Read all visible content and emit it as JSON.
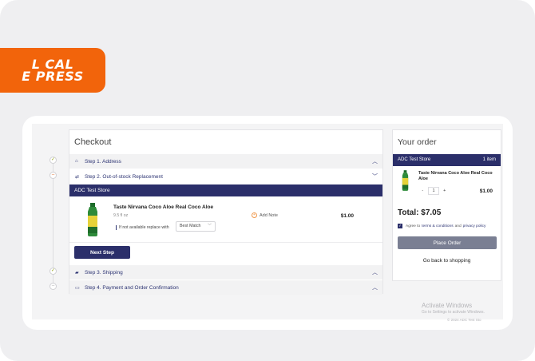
{
  "brand": {
    "logo_line1": "L CAL",
    "logo_line2": "E PRESS",
    "accent": "#f2640b",
    "navy": "#2b2f6a"
  },
  "checkout": {
    "title": "Checkout",
    "steps": [
      {
        "label": "Step 1. Address",
        "icon": "home-icon",
        "state": "collapsed",
        "status": "done"
      },
      {
        "label": "Step 2. Out-of-stock Replacement",
        "icon": "swap-icon",
        "state": "expanded",
        "status": "current"
      },
      {
        "label": "Step 3. Shipping",
        "icon": "truck-icon",
        "state": "collapsed",
        "status": "done"
      },
      {
        "label": "Step 4. Payment and Order Confirmation",
        "icon": "card-icon",
        "state": "collapsed",
        "status": "pending"
      }
    ],
    "store_name": "ADC Test Store",
    "product": {
      "name": "Taste Nirvana Coco Aloe Real Coco Aloe",
      "size": "9.5 fl oz",
      "replace_label": "If not available replace with",
      "replace_value": "Best Match",
      "note_label": "Add Note",
      "price": "$1.00"
    },
    "next_button": "Next Step"
  },
  "order": {
    "title": "Your order",
    "store_name": "ADC Test Store",
    "item_count": "1 item",
    "item_name": "Taste Nirvana Coco Aloe Real Coco Aloe",
    "minus": "-",
    "qty": "1",
    "plus": "+",
    "item_price": "$1.00",
    "total_label": "Total:",
    "total_value": "$7.05",
    "agree_prefix": "Agree to",
    "terms": "terms & conditions",
    "and": "and",
    "privacy": "privacy policy",
    "place_button": "Place Order",
    "back_link": "Go back to shopping"
  },
  "watermark": {
    "line1": "Activate Windows",
    "line2": "Go to Settings to activate Windows.",
    "footer": "© 2024 ADC Test Sto"
  }
}
